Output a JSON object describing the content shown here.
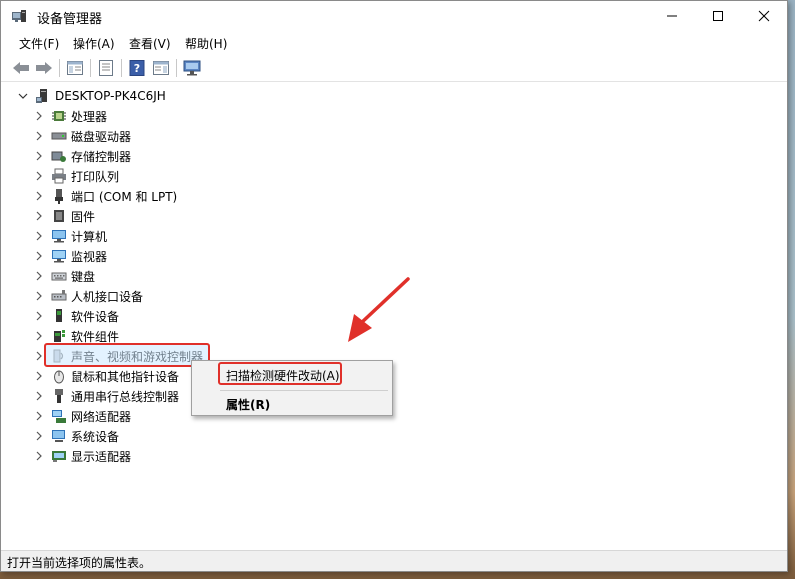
{
  "window": {
    "title": "设备管理器"
  },
  "menubar": {
    "items": [
      "文件(F)",
      "操作(A)",
      "查看(V)",
      "帮助(H)"
    ]
  },
  "tree": {
    "root": "DESKTOP-PK4C6JH",
    "items": [
      {
        "label": "处理器",
        "icon": "processor-icon"
      },
      {
        "label": "磁盘驱动器",
        "icon": "disk-drive-icon"
      },
      {
        "label": "存储控制器",
        "icon": "storage-controller-icon"
      },
      {
        "label": "打印队列",
        "icon": "printer-icon"
      },
      {
        "label": "端口 (COM 和 LPT)",
        "icon": "port-icon"
      },
      {
        "label": "固件",
        "icon": "firmware-icon"
      },
      {
        "label": "计算机",
        "icon": "computer-icon"
      },
      {
        "label": "监视器",
        "icon": "monitor-icon"
      },
      {
        "label": "键盘",
        "icon": "keyboard-icon"
      },
      {
        "label": "人机接口设备",
        "icon": "hid-icon"
      },
      {
        "label": "软件设备",
        "icon": "software-device-icon"
      },
      {
        "label": "软件组件",
        "icon": "software-component-icon"
      },
      {
        "label": "声音、视频和游戏控制器",
        "icon": "audio-icon"
      },
      {
        "label": "鼠标和其他指针设备",
        "icon": "mouse-icon"
      },
      {
        "label": "通用串行总线控制器",
        "icon": "usb-icon"
      },
      {
        "label": "网络适配器",
        "icon": "network-adapter-icon"
      },
      {
        "label": "系统设备",
        "icon": "system-device-icon"
      },
      {
        "label": "显示适配器",
        "icon": "display-adapter-icon"
      }
    ]
  },
  "context_menu": {
    "scan": "扫描检测硬件改动(A)",
    "properties": "属性(R)"
  },
  "status": {
    "text": "打开当前选择项的属性表。"
  },
  "colors": {
    "highlight_border": "#e0302a",
    "selection": "#cce8ff"
  }
}
